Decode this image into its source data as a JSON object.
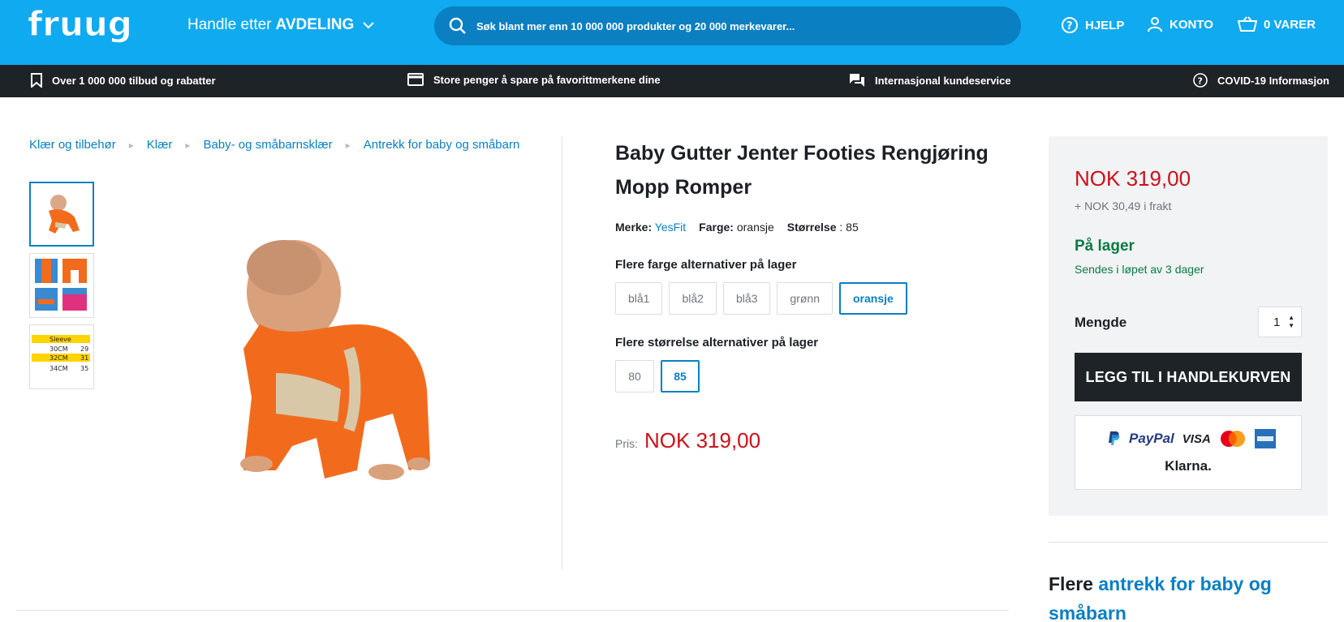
{
  "header": {
    "logo_text": "fruugo",
    "dept_prefix": "Handle etter",
    "dept_bold": "AVDELING",
    "search_placeholder": "Søk blant mer enn 10 000 000 produkter og 20 000 merkevarer...",
    "help": "HJELP",
    "account": "KONTO",
    "cart": "0 VARER",
    "bg_color": "#10aaf0"
  },
  "usp_bar": [
    {
      "icon": "bookmark-icon",
      "text": "Over 1 000 000 tilbud og rabatter"
    },
    {
      "icon": "credit-card-icon",
      "text": "Store penger å spare på favorittmerkene dine"
    },
    {
      "icon": "chat-icon",
      "text": "Internasjonal kundeservice"
    },
    {
      "icon": "help-circle-icon",
      "text": "COVID-19 Informasjon"
    }
  ],
  "breadcrumbs": [
    "Klær og tilbehør",
    "Klær",
    "Baby- og småbarnsklær",
    "Antrekk for baby og småbarn"
  ],
  "product": {
    "title": "Baby Gutter Jenter Footies Rengjøring Mopp Romper",
    "brand_label": "Merke:",
    "brand": "YesFit",
    "color_label": "Farge:",
    "color": "oransje",
    "size_label": "Størrelse",
    "size": ": 85",
    "color_options_title": "Flere farge alternativer på lager",
    "color_options": [
      "blå1",
      "blå2",
      "blå3",
      "grønn",
      "oransje"
    ],
    "selected_color": "oransje",
    "size_options_title": "Flere størrelse alternativer på lager",
    "size_options": [
      "80",
      "85"
    ],
    "selected_size": "85",
    "price_label": "Pris:",
    "price": "NOK 319,00",
    "size_chart_rows": [
      {
        "a": "Sleeve",
        "b": ""
      },
      {
        "a": "30CM",
        "b": "29"
      },
      {
        "a": "32CM",
        "b": "31"
      },
      {
        "a": "34CM",
        "b": "35"
      }
    ]
  },
  "buybox": {
    "price": "NOK 319,00",
    "shipping": "+ NOK 30,49 i frakt",
    "stock": "På lager",
    "dispatch": "Sendes i løpet av 3 dager",
    "qty_label": "Mengde",
    "qty": "1",
    "add_to_cart": "LEGG TIL I HANDLEKURVEN",
    "payment": {
      "paypal": "PayPal",
      "visa": "VISA",
      "klarna": "Klarna."
    }
  },
  "more": {
    "prefix": "Flere",
    "link": "antrekk for baby og småbarn"
  },
  "colors": {
    "accent": "#0a7fc2",
    "price": "#cc1019",
    "stock": "#0b7a43",
    "dark": "#1e2328"
  }
}
